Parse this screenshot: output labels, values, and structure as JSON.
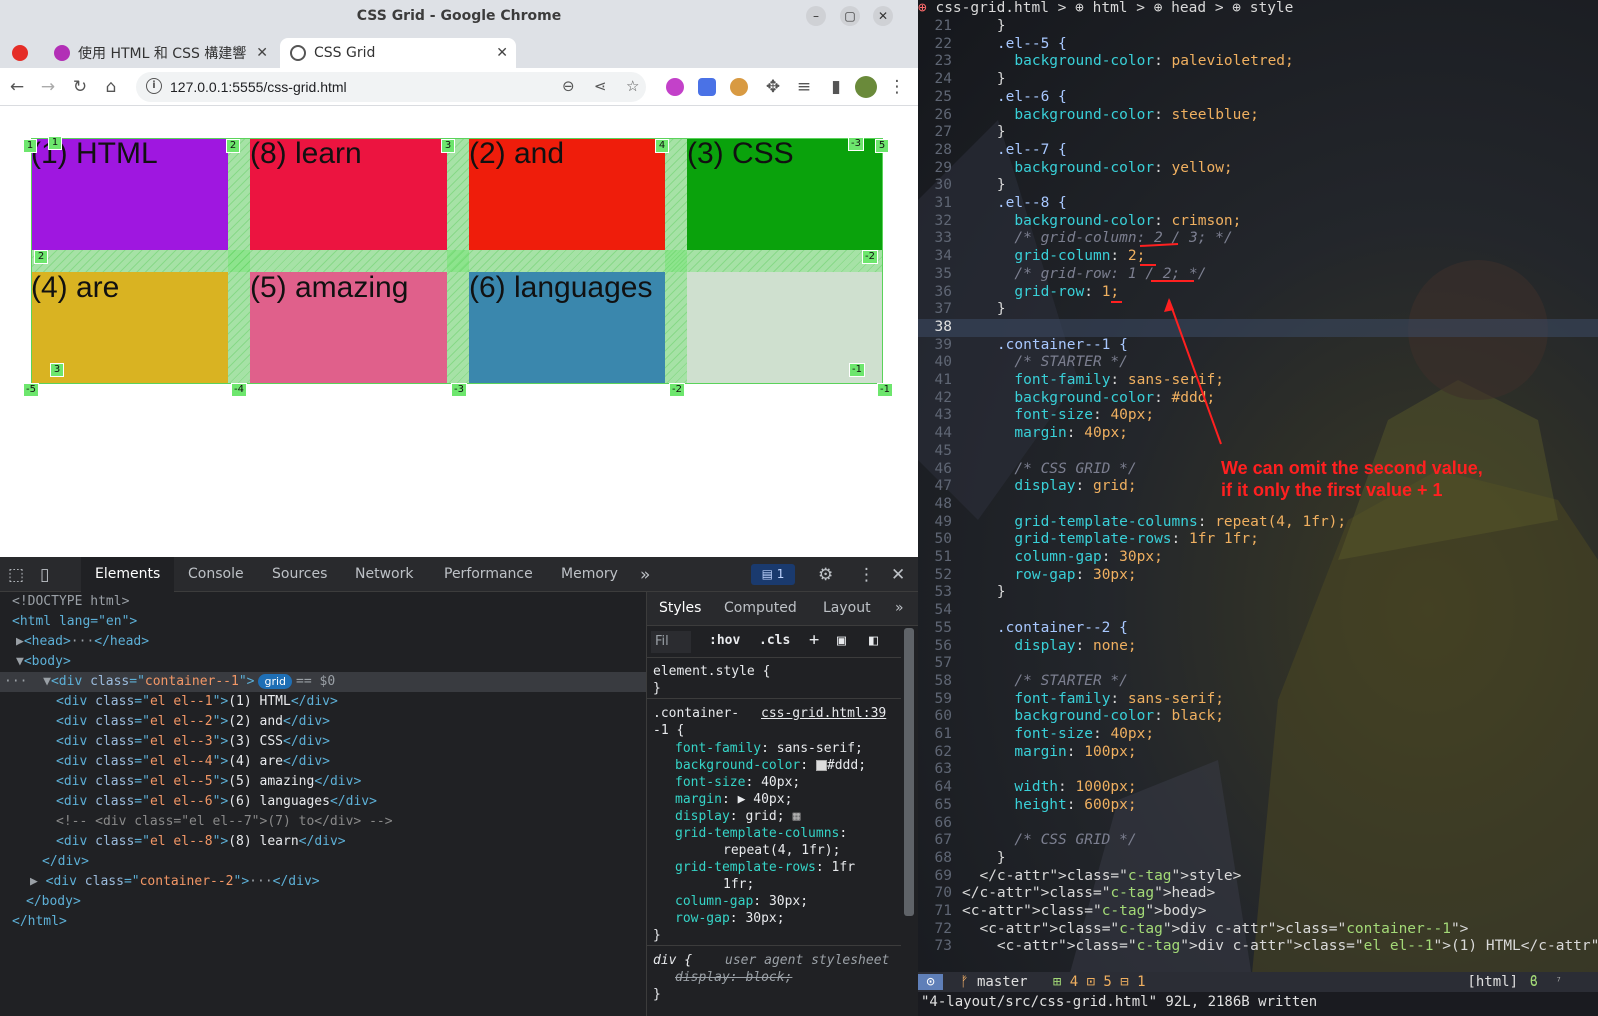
{
  "window": {
    "title": "CSS Grid - Google Chrome"
  },
  "tabs": [
    {
      "label": "使用 HTML 和 CSS 構建響",
      "active": false
    },
    {
      "label": "CSS Grid",
      "active": true
    }
  ],
  "address": {
    "url": "127.0.0.1:5555/css-grid.html"
  },
  "page": {
    "cells": {
      "c1": "(1) HTML",
      "c2": "(8) learn",
      "c3": "(2) and",
      "c4": "(3) CSS",
      "c5": "(4) are",
      "c6": "(5) amazing",
      "c7": "(6) languages"
    },
    "colors": {
      "c1": "#9f17e0",
      "c2": "#ec1440",
      "c3": "#ef1d0b",
      "c4": "#0aa20c",
      "c5": "#d9b322",
      "c6": "#e0608b",
      "c7": "#3a87ad",
      "container": "#dddddd"
    },
    "line_numbers": {
      "top": [
        "1",
        "2",
        "3",
        "4",
        "5"
      ],
      "top_neg": "-3",
      "row2_left": "2",
      "row2_right": "-2",
      "row3_left": "3",
      "row3_right": "-1",
      "bottom": [
        "-5",
        "-4",
        "-3",
        "-2",
        "-1"
      ],
      "first_corner": "1"
    }
  },
  "devtools": {
    "tabs": [
      "Elements",
      "Console",
      "Sources",
      "Network",
      "Performance",
      "Memory"
    ],
    "issues_count": "1",
    "elements_tree": {
      "doctype": "<!DOCTYPE html>",
      "html_open": "<html lang=\"en\">",
      "head": "<head>",
      "head_close": "</head>",
      "body": "<body>",
      "container1_class": "container--1",
      "grid_pill": "grid",
      "selected_marker": "== $0",
      "children": [
        {
          "cls": "el el--1",
          "text": "(1) HTML"
        },
        {
          "cls": "el el--2",
          "text": "(2) and"
        },
        {
          "cls": "el el--3",
          "text": "(3) CSS"
        },
        {
          "cls": "el el--4",
          "text": "(4) are"
        },
        {
          "cls": "el el--5",
          "text": "(5) amazing"
        },
        {
          "cls": "el el--6",
          "text": "(6) languages"
        }
      ],
      "comment": "<!-- <div class=\"el el--7\">(7) to</div> -->",
      "last_child": {
        "cls": "el el--8",
        "text": "(8) learn"
      },
      "container2_class": "container--2"
    },
    "styles_tabs": [
      "Styles",
      "Computed",
      "Layout"
    ],
    "filter_placeholder": "Fil",
    "hov": ":hov",
    "cls": ".cls",
    "element_style": "element.style {",
    "rule_selector_1": ".container-",
    "rule_selector_2": "-1 {",
    "rule_source": "css-grid.html:39",
    "props": [
      {
        "p": "font-family",
        "v": "sans-serif;"
      },
      {
        "p": "background-color",
        "v": "#ddd;"
      },
      {
        "p": "font-size",
        "v": "40px;"
      },
      {
        "p": "margin",
        "v": "40px;"
      },
      {
        "p": "display",
        "v": "grid;"
      },
      {
        "p": "grid-template-columns",
        "v": "repeat(4, 1fr);"
      },
      {
        "p": "grid-template-rows",
        "v": "1fr 1fr;"
      },
      {
        "p": "column-gap",
        "v": "30px;"
      },
      {
        "p": "row-gap",
        "v": "30px;"
      }
    ],
    "ua_selector": "div {",
    "ua_label": "user agent stylesheet",
    "ua_prop": "display: block;"
  },
  "editor": {
    "breadcrumb": "css-grid.html > ⊕ html > ⊕ head > ⊕ style",
    "annotation_line1": "We can omit the second value,",
    "annotation_line2": "if it only the first value + 1",
    "status_mode": "master",
    "status_counts": "4 ⊡ 5 ⊟ 1",
    "status_filetype": "[html]",
    "cmdline": "\"4-layout/src/css-grid.html\" 92L, 2186B written"
  }
}
